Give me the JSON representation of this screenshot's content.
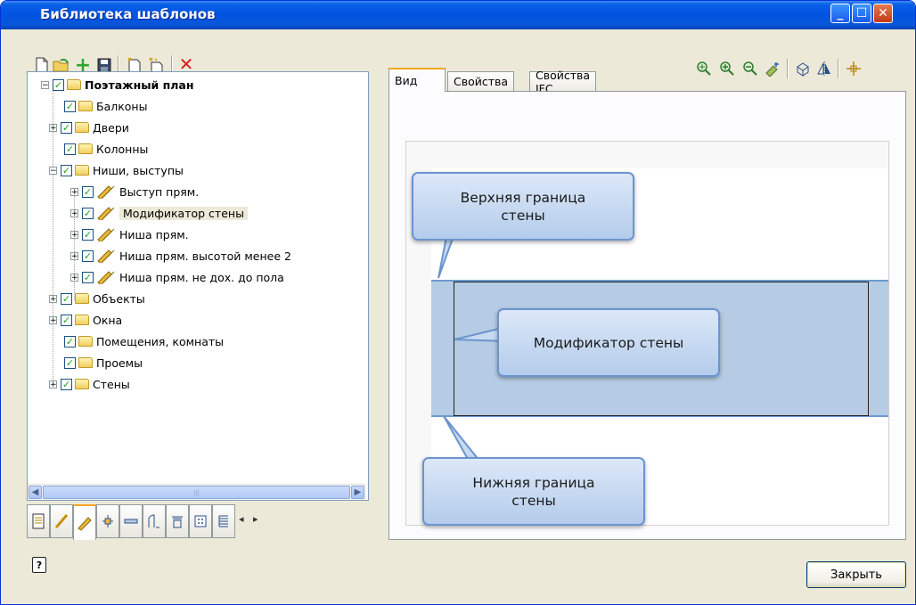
{
  "window": {
    "title": "Библиотека шаблонов"
  },
  "toolbar_left": [
    "new-icon",
    "open-icon",
    "add-icon",
    "save-icon",
    "new-template-icon",
    "template-wizard-icon",
    "delete-icon"
  ],
  "toolbar_right": [
    "zoom-all-icon",
    "zoom-in-icon",
    "zoom-out-icon",
    "zoom-window-icon",
    "view-3d-icon",
    "mirror-icon",
    "snap-point-icon"
  ],
  "tree": {
    "root": "Поэтажный план",
    "items": [
      {
        "label": "Балконы"
      },
      {
        "label": "Двери"
      },
      {
        "label": "Колонны"
      },
      {
        "label": "Ниши, выступы"
      },
      {
        "label": "Выступ прям."
      },
      {
        "label": "Модификатор стены"
      },
      {
        "label": "Ниша прям."
      },
      {
        "label": "Ниша прям. высотой менее 2"
      },
      {
        "label": "Ниша прям. не дох. до пола"
      },
      {
        "label": "Объекты"
      },
      {
        "label": "Окна"
      },
      {
        "label": "Помещения, комнаты"
      },
      {
        "label": "Проемы"
      },
      {
        "label": "Стены"
      }
    ],
    "selected": "Модификатор стены"
  },
  "view_tabs": [
    "Вид",
    "Свойства",
    "Свойства IFC"
  ],
  "active_view_tab": "Вид",
  "callouts": {
    "top": [
      "Верхняя граница",
      "стены"
    ],
    "middle": "Модификатор стены",
    "bottom": [
      "Нижняя граница",
      "стены"
    ]
  },
  "buttons": {
    "close": "Закрыть"
  },
  "colors": {
    "titlebar": "#0054e3",
    "wall_fill": "#b6cce4",
    "callout_border": "#6b94cf",
    "tab_highlight": "#f5a623"
  }
}
